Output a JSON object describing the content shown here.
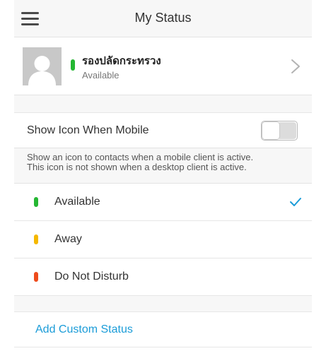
{
  "header": {
    "title": "My Status"
  },
  "profile": {
    "name": "รองปลัดกระทรวง",
    "status": "Available",
    "status_color": "#25b733"
  },
  "mobile_toggle": {
    "label": "Show Icon When Mobile",
    "enabled": false,
    "help_lines": [
      "Show an icon to contacts when a mobile client is active.",
      "This icon is not shown when a desktop client is active."
    ]
  },
  "statuses": [
    {
      "label": "Available",
      "color": "#25b733",
      "selected": true
    },
    {
      "label": "Away",
      "color": "#f5b800",
      "selected": false
    },
    {
      "label": "Do Not Disturb",
      "color": "#ee4b1c",
      "selected": false
    }
  ],
  "custom_status": {
    "label": "Add Custom Status",
    "color": "#1b9cd8"
  },
  "icons": {
    "menu": "menu-icon",
    "avatar": "avatar-placeholder-icon",
    "chevron": "chevron-right-icon",
    "check": "checkmark-icon"
  }
}
